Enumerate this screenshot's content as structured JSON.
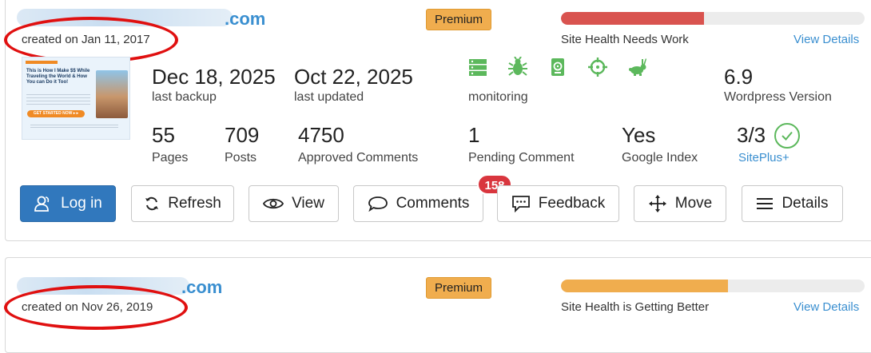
{
  "sites": [
    {
      "domain_suffix": ".com",
      "created": "created on Jan 11, 2017",
      "plan": "Premium",
      "health": {
        "label": "Site Health Needs Work",
        "fraction": 0.47,
        "color": "#d9534f"
      },
      "view_details": "View Details",
      "thumbnail": {
        "headline": "This is How I Make $$ While Traveling the World & How You can Do it Too!",
        "cta": "GET STARTED NOW ▸ ▸"
      },
      "stats_top": [
        {
          "value": "Dec 18, 2025",
          "label": "last backup"
        },
        {
          "value": "Oct 22, 2025",
          "label": "last updated"
        }
      ],
      "monitoring_label": "monitoring",
      "monitor_icons": [
        "server-icon",
        "bug-icon",
        "backup-drive-icon",
        "crosshair-icon",
        "rabbit-icon"
      ],
      "wp_version": {
        "value": "6.9",
        "label": "Wordpress Version"
      },
      "stats_bottom": [
        {
          "value": "55",
          "label": "Pages"
        },
        {
          "value": "709",
          "label": "Posts"
        },
        {
          "value": "4750",
          "label": "Approved Comments"
        },
        {
          "value": "1",
          "label": "Pending Comment"
        },
        {
          "value": "Yes",
          "label": "Google Index"
        }
      ],
      "siteplus": {
        "value": "3/3",
        "label": "SitePlus+"
      },
      "actions": {
        "login": "Log in",
        "refresh": "Refresh",
        "view": "View",
        "comments": "Comments",
        "comments_badge": "158",
        "feedback": "Feedback",
        "move": "Move",
        "details": "Details"
      }
    },
    {
      "domain_suffix": ".com",
      "created": "created on Nov 26, 2019",
      "plan": "Premium",
      "health": {
        "label": "Site Health is Getting Better",
        "fraction": 0.55,
        "color": "#f0ad4e"
      },
      "view_details": "View Details"
    }
  ],
  "colors": {
    "accent": "#3a8fd0",
    "monitor_green": "#5cb85c",
    "annotation_red": "#e01010"
  }
}
